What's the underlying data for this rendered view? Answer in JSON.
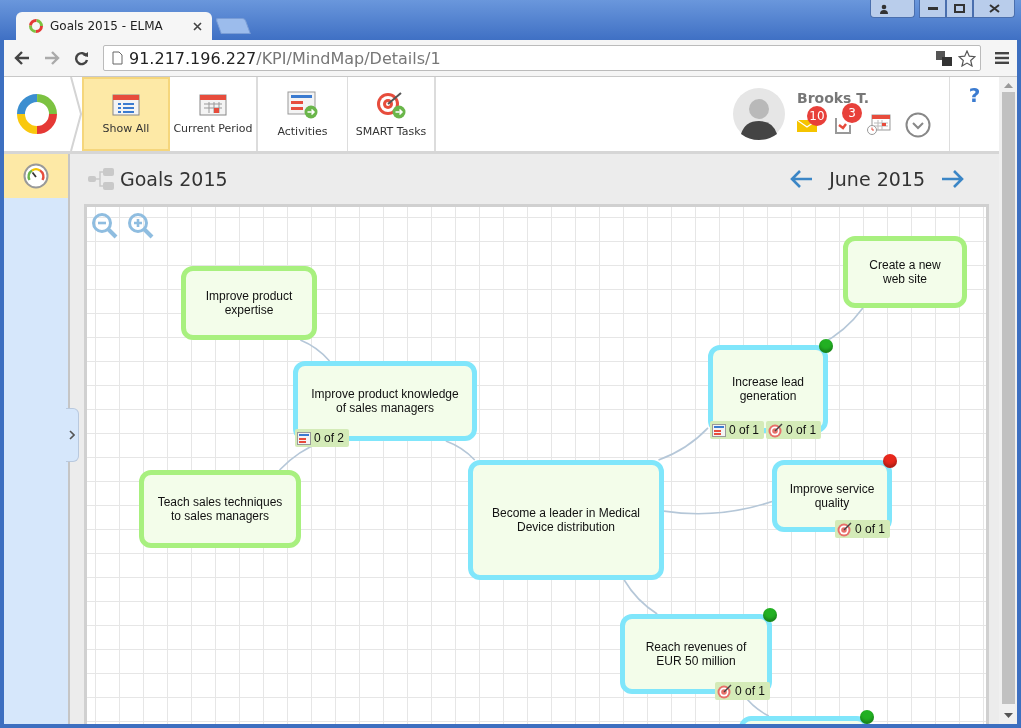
{
  "browser": {
    "tab": {
      "title": "Goals 2015 - ELMA"
    },
    "address": {
      "host": "91.217.196.227",
      "path": "/KPI/MindMap/Details/1"
    }
  },
  "toolbar": [
    {
      "label": "Show All",
      "kind": "list",
      "selected": true
    },
    {
      "label": "Current Period",
      "kind": "period",
      "selected": false
    },
    {
      "label": "Activities",
      "kind": "activities",
      "selected": false
    },
    {
      "label": "SMART Tasks",
      "kind": "smart",
      "selected": false
    }
  ],
  "user": {
    "name": "Brooks T.",
    "messages": "10",
    "tasks": "3"
  },
  "help": "?",
  "sidebar": {
    "items": [
      {
        "selected": true
      }
    ]
  },
  "page": {
    "title": "Goals 2015",
    "period": "June 2015"
  },
  "mindmap": {
    "root": {
      "text": "Become a leader in Medical Device distribution",
      "color": "#80e6fb",
      "children": [
        {
          "text": "Improve product knowledge of sales managers",
          "color": "#80e6fb",
          "badges": [
            {
              "kind": "activities",
              "text": "0 of 2"
            }
          ],
          "children": [
            {
              "text": "Improve product expertise",
              "color": "#a8f07f"
            },
            {
              "text": "Teach sales techniques to sales managers",
              "color": "#a8f07f"
            }
          ]
        },
        {
          "text": "Increase lead generation",
          "color": "#80e6fb",
          "status": {
            "color": "#22b022"
          },
          "badges": [
            {
              "kind": "activities",
              "text": "0 of 1"
            },
            {
              "kind": "smart",
              "text": "0 of 1"
            }
          ],
          "children": [
            {
              "text": "Create a new web site",
              "color": "#a8f07f"
            }
          ]
        },
        {
          "text": "Improve service quality",
          "color": "#80e6fb",
          "status": {
            "color": "#e8281c"
          },
          "badges": [
            {
              "kind": "smart",
              "text": "0 of 1"
            }
          ]
        },
        {
          "text": "Reach revenues of EUR 50 million",
          "color": "#80e6fb",
          "status": {
            "color": "#22b022"
          },
          "badges": [
            {
              "kind": "smart",
              "text": "0 of 1"
            }
          ],
          "children": [
            {
              "color": "#80e6fb",
              "status": {
                "color": "#22b022"
              }
            }
          ]
        }
      ]
    }
  }
}
